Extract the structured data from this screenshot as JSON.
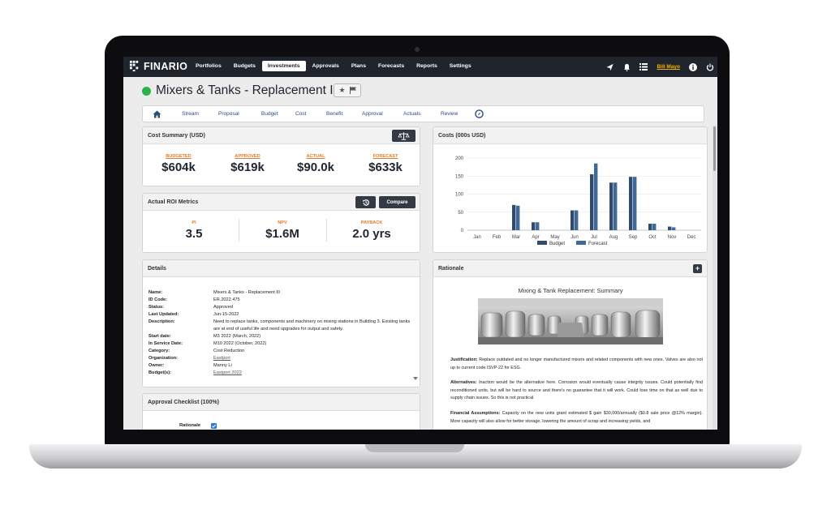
{
  "app": {
    "logo_text": "FINARIO"
  },
  "nav": {
    "items": [
      "Portfolios",
      "Budgets",
      "Investments",
      "Approvals",
      "Plans",
      "Forecasts",
      "Reports",
      "Settings"
    ],
    "active": "Investments"
  },
  "user": {
    "name": "Bill Mayo"
  },
  "page": {
    "title": "Mixers & Tanks - Replacement III",
    "status_color": "#2bb04a"
  },
  "tabs": [
    "Stream",
    "Proposal",
    "Budget",
    "Cost",
    "Benefit",
    "Approval",
    "Actuals",
    "Review"
  ],
  "cost_summary": {
    "title": "Cost Summary (USD)",
    "metrics": [
      {
        "label": "BUDGETED",
        "value": "$604k"
      },
      {
        "label": "APPROVED",
        "value": "$619k"
      },
      {
        "label": "ACTUAL",
        "value": "$90.0k"
      },
      {
        "label": "FORECAST",
        "value": "$633k"
      }
    ]
  },
  "roi": {
    "title": "Actual ROI Metrics",
    "compare_label": "Compare",
    "metrics": [
      {
        "label": "PI",
        "value": "3.5"
      },
      {
        "label": "NPV",
        "value": "$1.6M"
      },
      {
        "label": "PAYBACK",
        "value": "2.0 yrs"
      }
    ]
  },
  "details": {
    "title": "Details",
    "rows": [
      {
        "key": "Name:",
        "value": "Mixers & Tanks - Replacement III"
      },
      {
        "key": "ID Code:",
        "value": "ER.2022.475"
      },
      {
        "key": "Status:",
        "value": "Approved"
      },
      {
        "key": "Last Updated:",
        "value": "Jun-15-2022"
      },
      {
        "key": "Description:",
        "value": "Need to replace tanks, components and machinery on mixing stations in Building 3. Existing tanks are at end of useful life and need upgrades for output and safety."
      },
      {
        "key": "Start date:",
        "value": "M3 2022 (March, 2022)"
      },
      {
        "key": "In Service Date:",
        "value": "M10 2022 (October, 2022)"
      },
      {
        "key": "Category:",
        "value": "Cost Reduction"
      },
      {
        "key": "Organization:",
        "value": "Eastport"
      },
      {
        "key": "Owner:",
        "value": "Manny Li"
      },
      {
        "key": "Budget(s):",
        "value": "Eastport 2022"
      }
    ]
  },
  "checklist": {
    "title": "Approval Checklist (100%)",
    "item": "Rationale"
  },
  "costs_chart": {
    "title": "Costs (000s USD)"
  },
  "chart_data": {
    "type": "bar",
    "categories": [
      "Jan",
      "Feb",
      "Mar",
      "Apr",
      "May",
      "Jun",
      "Jul",
      "Aug",
      "Sep",
      "Oct",
      "Nov",
      "Dec"
    ],
    "series": [
      {
        "name": "Budget",
        "values": [
          0,
          0,
          70,
          22,
          0,
          55,
          155,
          132,
          148,
          18,
          10,
          0
        ]
      },
      {
        "name": "Forecast",
        "values": [
          0,
          0,
          68,
          22,
          0,
          55,
          185,
          132,
          148,
          18,
          8,
          0
        ]
      }
    ],
    "ylim": [
      0,
      200
    ],
    "yticks": [
      0,
      50,
      100,
      150,
      200
    ],
    "legend": "bottom",
    "grid": true,
    "colors": {
      "Budget": "#2f4b6e",
      "Forecast": "#3f6a96"
    }
  },
  "rationale": {
    "title": "Rationale",
    "doc_title": "Mixing & Tank Replacement: Summary",
    "justification_label": "Justification:",
    "justification": "Replace outdated and no longer manufactured mixers and related components with new ones. Valves are also not up to current code ISVP-22 for ESG.",
    "alternatives_label": "Alternatives:",
    "alternatives": "Inaction would be the alternative here. Corrosion would eventually cause integrity issues. Could potentially find reconditioned units, but will be hard to source and there's no guarantee that it will work. Could lose time on that as well due to supply chain issues. So this is not practical.",
    "financial_label": "Financial Assumptions:",
    "financial": "Capacity on the new units grant estimated $ gain $30,000/annually ($0.8 sale price @12% margin). More capacity will also allow for better storage, lowering the amount of scrap and increasing yields, and"
  }
}
